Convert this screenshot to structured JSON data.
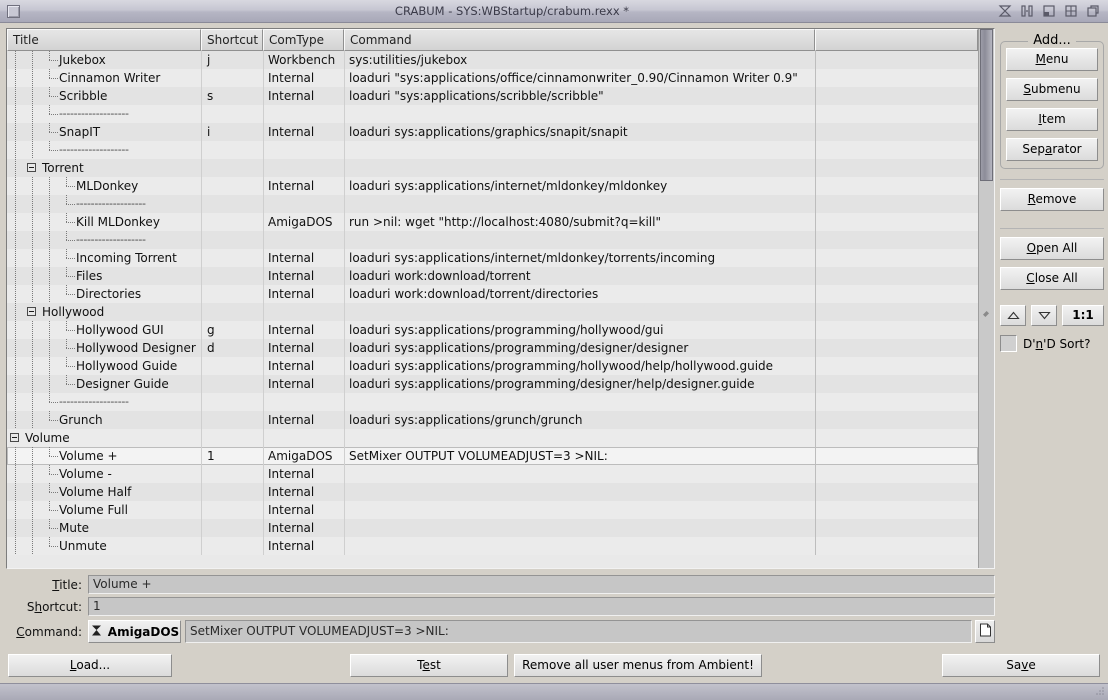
{
  "window": {
    "title": "CRABUM - SYS:WBStartup/crabum.rexx *",
    "controls": [
      "zoom-icon",
      "depth-icon",
      "iconify-icon",
      "maximize-icon",
      "restore-icon"
    ]
  },
  "list": {
    "columns": [
      "Title",
      "Shortcut",
      "ComType",
      "Command",
      ""
    ],
    "rows": [
      {
        "indent": 2,
        "knob": "tee",
        "title": "Jukebox",
        "shortcut": "j",
        "type": "Workbench",
        "command": "sys:utilities/jukebox"
      },
      {
        "indent": 2,
        "knob": "tee",
        "title": "Cinnamon Writer",
        "shortcut": "",
        "type": "Internal",
        "command": "loaduri \"sys:applications/office/cinnamonwriter_0.90/Cinnamon Writer 0.9\""
      },
      {
        "indent": 2,
        "knob": "tee",
        "title": "Scribble",
        "shortcut": "s",
        "type": "Internal",
        "command": "loaduri \"sys:applications/scribble/scribble\""
      },
      {
        "indent": 2,
        "knob": "dash",
        "title": "-------------------",
        "shortcut": "",
        "type": "",
        "command": "",
        "separator": true
      },
      {
        "indent": 2,
        "knob": "tee",
        "title": "SnapIT",
        "shortcut": "i",
        "type": "Internal",
        "command": "loaduri sys:applications/graphics/snapit/snapit"
      },
      {
        "indent": 2,
        "knob": "dash",
        "title": "-------------------",
        "shortcut": "",
        "type": "",
        "command": "",
        "separator": true
      },
      {
        "indent": 1,
        "knob": "box",
        "title": "Torrent",
        "shortcut": "",
        "type": "",
        "command": ""
      },
      {
        "indent": 3,
        "knob": "tee",
        "title": "MLDonkey",
        "shortcut": "",
        "type": "Internal",
        "command": "loaduri sys:applications/internet/mldonkey/mldonkey"
      },
      {
        "indent": 3,
        "knob": "dash",
        "title": "-------------------",
        "shortcut": "",
        "type": "",
        "command": "",
        "separator": true
      },
      {
        "indent": 3,
        "knob": "tee",
        "title": "Kill MLDonkey",
        "shortcut": "",
        "type": "AmigaDOS",
        "command": "run >nil: wget \"http://localhost:4080/submit?q=kill\""
      },
      {
        "indent": 3,
        "knob": "dash",
        "title": "-------------------",
        "shortcut": "",
        "type": "",
        "command": "",
        "separator": true
      },
      {
        "indent": 3,
        "knob": "tee",
        "title": "Incoming Torrent",
        "shortcut": "",
        "type": "Internal",
        "command": "loaduri sys:applications/internet/mldonkey/torrents/incoming"
      },
      {
        "indent": 3,
        "knob": "tee",
        "title": "Files",
        "shortcut": "",
        "type": "Internal",
        "command": "loaduri work:download/torrent"
      },
      {
        "indent": 3,
        "knob": "last",
        "title": "Directories",
        "shortcut": "",
        "type": "Internal",
        "command": "loaduri work:download/torrent/directories"
      },
      {
        "indent": 1,
        "knob": "box",
        "title": "Hollywood",
        "shortcut": "",
        "type": "",
        "command": ""
      },
      {
        "indent": 3,
        "knob": "tee",
        "title": "Hollywood GUI",
        "shortcut": "g",
        "type": "Internal",
        "command": "loaduri sys:applications/programming/hollywood/gui"
      },
      {
        "indent": 3,
        "knob": "tee",
        "title": "Hollywood Designer",
        "shortcut": "d",
        "type": "Internal",
        "command": "loaduri sys:applications/programming/designer/designer"
      },
      {
        "indent": 3,
        "knob": "tee",
        "title": "Hollywood Guide",
        "shortcut": "",
        "type": "Internal",
        "command": "loaduri sys:applications/programming/hollywood/help/hollywood.guide"
      },
      {
        "indent": 3,
        "knob": "last",
        "title": "Designer Guide",
        "shortcut": "",
        "type": "Internal",
        "command": "loaduri sys:applications/programming/designer/help/designer.guide"
      },
      {
        "indent": 2,
        "knob": "dash",
        "title": "-------------------",
        "shortcut": "",
        "type": "",
        "command": "",
        "separator": true
      },
      {
        "indent": 2,
        "knob": "last",
        "title": "Grunch",
        "shortcut": "",
        "type": "Internal",
        "command": "loaduri sys:applications/grunch/grunch"
      },
      {
        "indent": 0,
        "knob": "box",
        "title": "Volume",
        "shortcut": "",
        "type": "",
        "command": ""
      },
      {
        "indent": 2,
        "knob": "tee",
        "title": "Volume +",
        "shortcut": "1",
        "type": "AmigaDOS",
        "command": "SetMixer OUTPUT VOLUMEADJUST=3 >NIL:",
        "selected": true
      },
      {
        "indent": 2,
        "knob": "tee",
        "title": "Volume -",
        "shortcut": "",
        "type": "Internal",
        "command": ""
      },
      {
        "indent": 2,
        "knob": "tee",
        "title": "Volume Half",
        "shortcut": "",
        "type": "Internal",
        "command": ""
      },
      {
        "indent": 2,
        "knob": "tee",
        "title": "Volume Full",
        "shortcut": "",
        "type": "Internal",
        "command": ""
      },
      {
        "indent": 2,
        "knob": "tee",
        "title": "Mute",
        "shortcut": "",
        "type": "Internal",
        "command": ""
      },
      {
        "indent": 2,
        "knob": "last",
        "title": "Unmute",
        "shortcut": "",
        "type": "Internal",
        "command": ""
      }
    ]
  },
  "form": {
    "title_label": "Title:",
    "title_accel": "T",
    "title_value": "Volume +",
    "shortcut_label": "Shortcut:",
    "shortcut_accel": "h",
    "shortcut_value": "1",
    "command_label": "Command:",
    "command_accel": "C",
    "command_type": "AmigaDOS",
    "command_type_icon": "amigados-icon",
    "command_value": "SetMixer OUTPUT VOLUMEADJUST=3 >NIL:",
    "file_button_icon": "file-page-icon"
  },
  "sidebar": {
    "add_group_label": "Add...",
    "add_buttons": [
      {
        "label": "Menu",
        "accel": "M"
      },
      {
        "label": "Submenu",
        "accel": "S"
      },
      {
        "label": "Item",
        "accel": "I"
      },
      {
        "label": "Separator",
        "accel": "a"
      }
    ],
    "remove_label": "Remove",
    "remove_accel": "R",
    "open_all_label": "Open All",
    "open_all_accel": "O",
    "close_all_label": "Close All",
    "close_all_accel": "C",
    "move_up_icon": "triangle-up-icon",
    "move_down_icon": "triangle-down-icon",
    "ratio_label": "1:1",
    "dnd_sort_label": "D'n'D Sort?",
    "dnd_sort_accel": "n",
    "dnd_sort_checked": false
  },
  "footer": {
    "load_label": "Load...",
    "load_accel": "L",
    "test_label": "Test",
    "test_accel": "e",
    "remove_all_label": "Remove all user menus from Ambient!",
    "save_label": "Save",
    "save_accel": "v"
  },
  "colors": {
    "window_bg": "#d4d0c8",
    "titlebar": "#b6b6c4",
    "row_odd": "#e3e3e3",
    "row_even": "#ebebeb",
    "row_selected": "#f3f3f3"
  }
}
